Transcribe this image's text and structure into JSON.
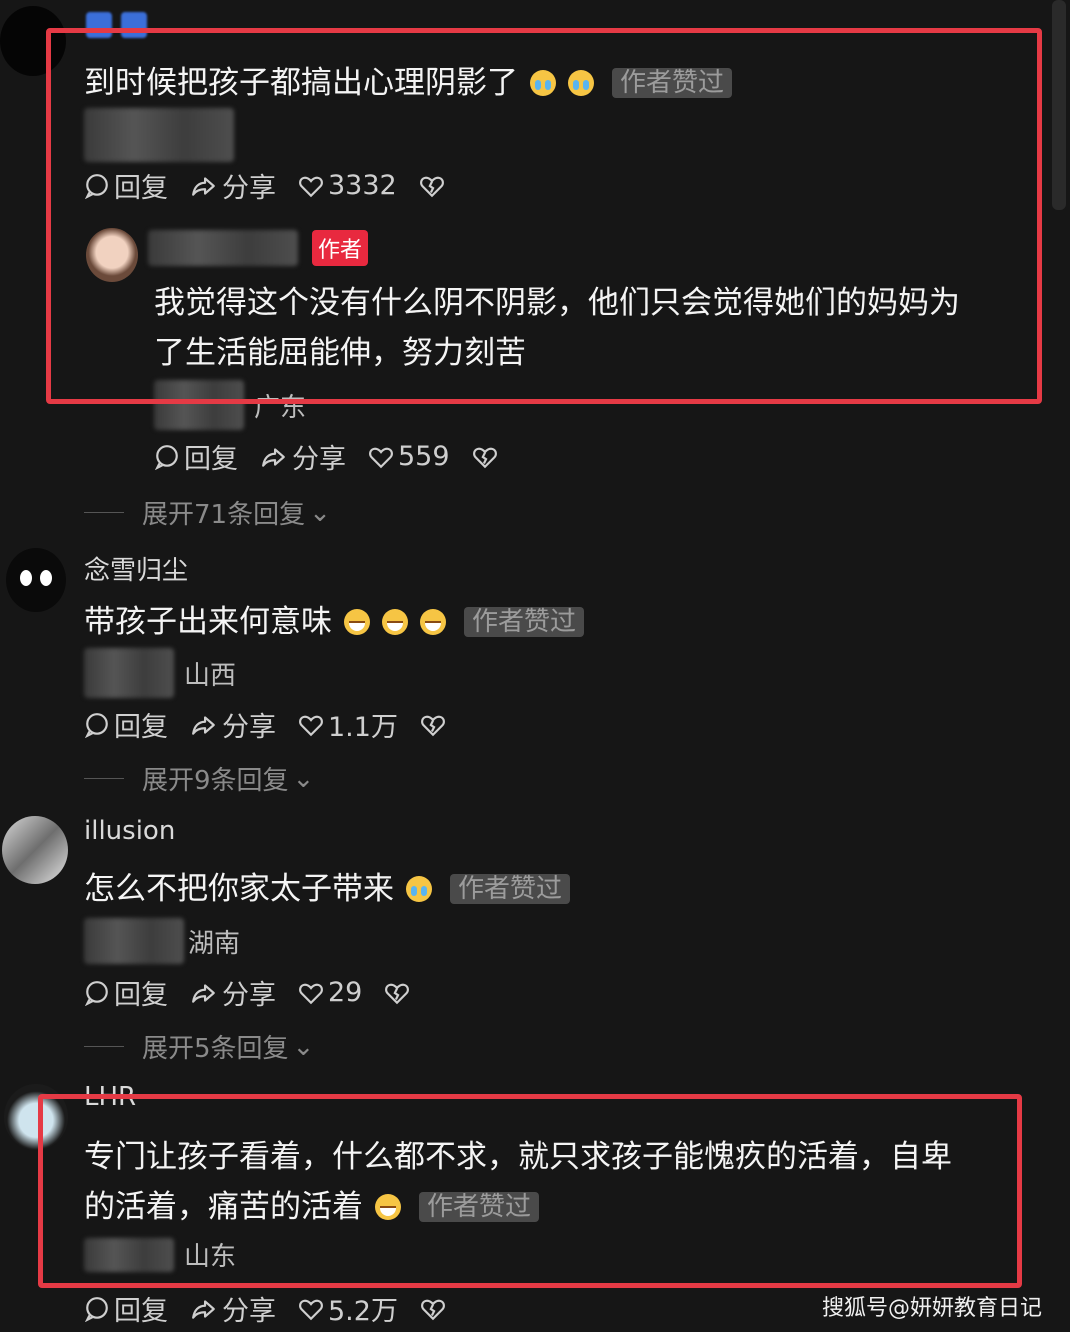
{
  "comments": [
    {
      "text": "到时候把孩子都搞出心理阴影了",
      "badge": "作者赞过",
      "reply": "回复",
      "share": "分享",
      "likes": "3332",
      "author_reply": {
        "tag": "作者",
        "text_line1": "我觉得这个没有什么阴不阴影，他们只会觉得她们的妈妈为",
        "text_line2": "了生活能屈能伸，努力刻苦",
        "location": "广东",
        "reply": "回复",
        "share": "分享",
        "likes": "559"
      },
      "expand": "展开71条回复"
    },
    {
      "username": "念雪归尘",
      "text": "带孩子出来何意味",
      "badge": "作者赞过",
      "location": "山西",
      "reply": "回复",
      "share": "分享",
      "likes": "1.1万",
      "expand": "展开9条回复"
    },
    {
      "username": "illusion",
      "text": "怎么不把你家太子带来",
      "badge": "作者赞过",
      "location": "湖南",
      "reply": "回复",
      "share": "分享",
      "likes": "29",
      "expand": "展开5条回复"
    },
    {
      "username": "LHR",
      "text_line1": "专门让孩子看着，什么都不求，就只求孩子能愧疚的活着，自卑",
      "text_line2": "的活着，痛苦的活着",
      "badge": "作者赞过",
      "location": "山东",
      "reply": "回复",
      "share": "分享",
      "likes": "5.2万"
    }
  ],
  "watermark": "搜狐号@妍妍教育日记",
  "colors": {
    "background": "#161616",
    "highlight_box": "#e53a45",
    "author_tag": "#e8293f"
  }
}
